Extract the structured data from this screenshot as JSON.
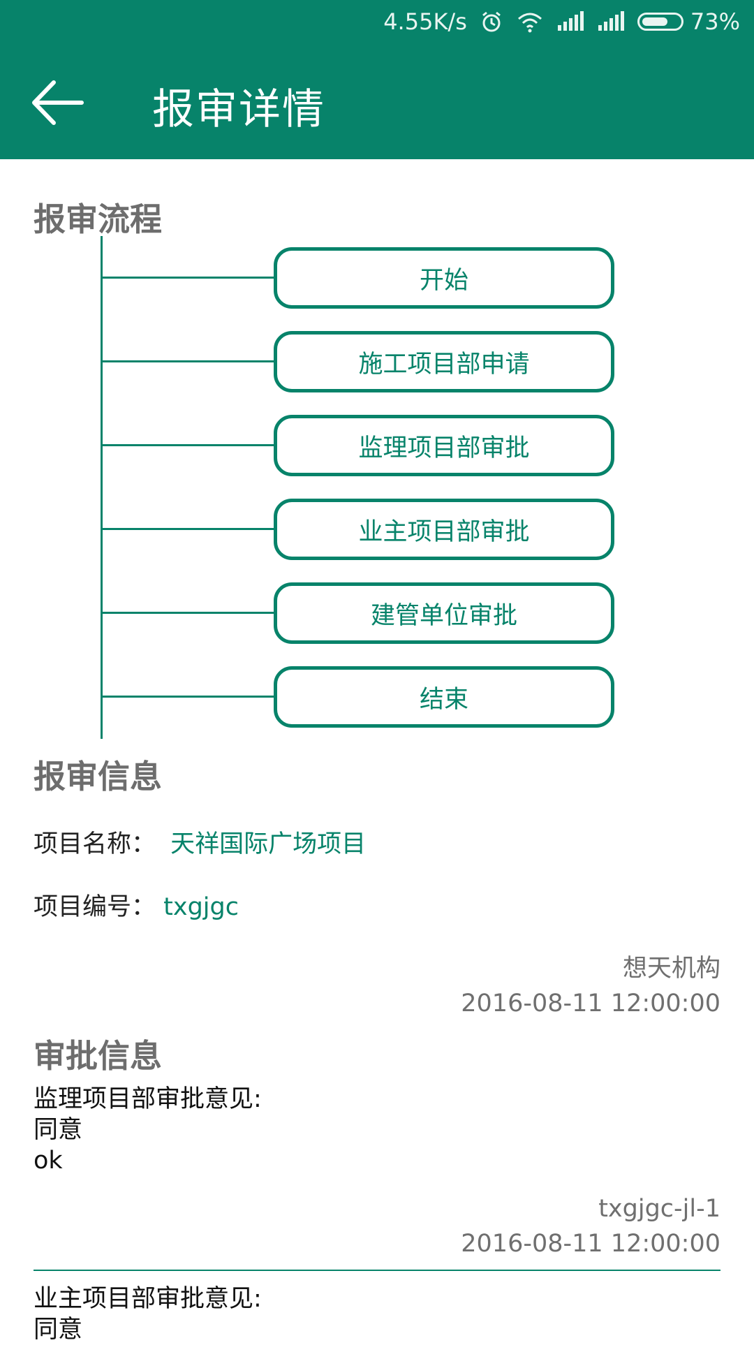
{
  "status_bar": {
    "speed": "4.55K/s",
    "battery": "73%",
    "icons": [
      "alarm-icon",
      "wifi-icon",
      "signal-icon",
      "signal-icon",
      "battery-icon"
    ]
  },
  "app_bar": {
    "title": "报审详情",
    "back_icon": "arrow-left-icon"
  },
  "flow": {
    "title": "报审流程",
    "steps": [
      "开始",
      "施工项目部申请",
      "监理项目部审批",
      "业主项目部审批",
      "建管单位审批",
      "结束"
    ]
  },
  "info": {
    "title": "报审信息",
    "project_name_label": "项目名称：",
    "project_name": "天祥国际广场项目",
    "project_code_label": "项目编号：",
    "project_code": "txgjgc",
    "org": "想天机构",
    "time": "2016-08-11 12:00:00"
  },
  "approval": {
    "title": "审批信息",
    "items": [
      {
        "label": "监理项目部审批意见:",
        "opinion": "同意",
        "comment": "ok",
        "user": "txgjgc-jl-1",
        "time": "2016-08-11 12:00:00"
      },
      {
        "label": "业主项目部审批意见:",
        "opinion": "同意"
      }
    ]
  },
  "colors": {
    "primary": "#07836a",
    "section_title": "#6d6d6d",
    "meta_text": "#6f6f6f"
  }
}
